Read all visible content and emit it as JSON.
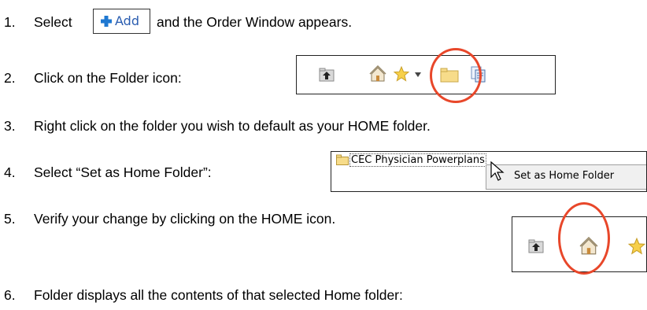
{
  "steps": [
    {
      "num": "1.",
      "before": "Select",
      "after": "and the Order Window appears."
    },
    {
      "num": "2.",
      "text": "Click on the Folder icon:"
    },
    {
      "num": "3.",
      "text": "Right click on the folder you wish to default as your HOME folder."
    },
    {
      "num": "4.",
      "text": "Select “Set as Home Folder”:"
    },
    {
      "num": "5.",
      "text": "Verify your change by clicking on the HOME icon."
    },
    {
      "num": "6.",
      "text": "Folder displays all the contents of that selected Home folder:"
    }
  ],
  "add_button": {
    "label": "Add",
    "icon": "plus-icon",
    "icon_color": "#1f78d1"
  },
  "toolbar_icons": [
    "up-folder-icon",
    "home-icon",
    "star-icon",
    "dropdown-arrow-icon",
    "folder-icon",
    "copy-icon"
  ],
  "context_menu": {
    "folder_name": "CEC Physician Powerplans",
    "menu_item": "Set as Home Folder"
  },
  "callout_color": "#e8472a"
}
